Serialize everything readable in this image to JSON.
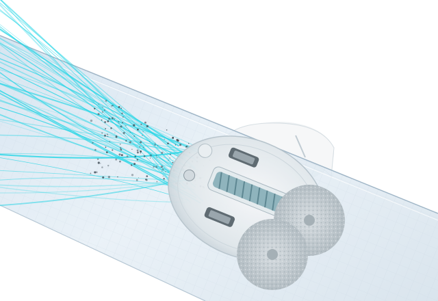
{
  "scene": {
    "subject": "robot-vacuum-underside",
    "colors": {
      "background": "#ffffff",
      "glass": "#dfe9f2",
      "glass_edge": "#b9c9d8",
      "airflow": "#29d6e6",
      "robot_body": "#f3f4f5",
      "robot_base": "#c9d2d9",
      "brush": "#7ba8b3",
      "mop_pad": "#c4ccd1",
      "dust": "#3a4650"
    }
  }
}
